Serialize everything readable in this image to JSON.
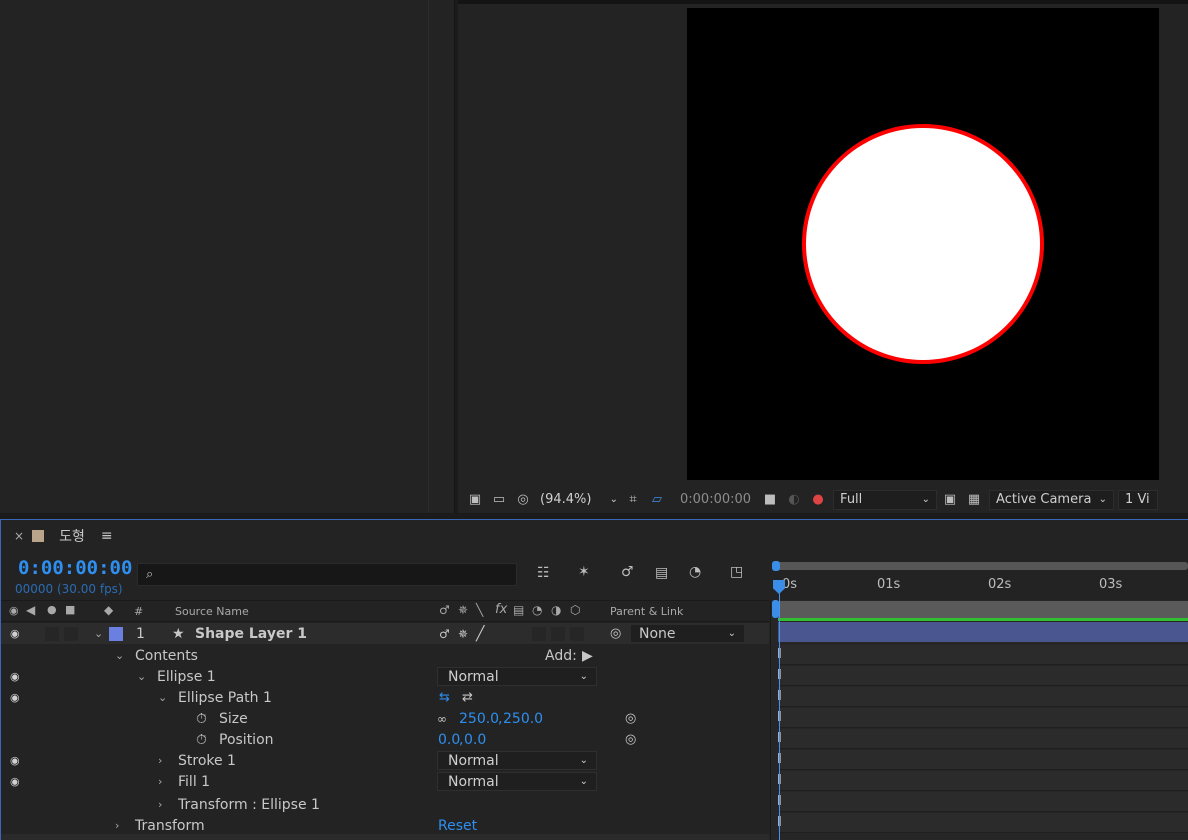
{
  "viewer": {
    "zoom": "(94.4%)",
    "time": "0:00:00:00",
    "resolution": "Full",
    "camera": "Active Camera",
    "views": "1 Vi"
  },
  "timeline": {
    "tab_close": "×",
    "tab_title": "도형",
    "tab_menu": "≡",
    "timecode": "0:00:00:00",
    "frames": "00000 (30.00 fps)",
    "search_placeholder": "",
    "columns": {
      "number": "#",
      "source_name": "Source Name",
      "parent_link": "Parent & Link",
      "fx": "fx"
    },
    "ruler": [
      "0s",
      "01s",
      "02s",
      "03s"
    ],
    "layer": {
      "number": "1",
      "name": "Shape Layer 1",
      "parent": "None",
      "label_color": "#6a7fe0"
    },
    "rows": {
      "contents": "Contents",
      "add_label": "Add:",
      "ellipse1": "Ellipse 1",
      "ellipse1_mode": "Normal",
      "ellipse_path": "Ellipse Path 1",
      "size": "Size",
      "size_value_x": "250.0",
      "size_value_y": "250.0",
      "position": "Position",
      "position_value_x": "0.0",
      "position_value_y": "0.0",
      "stroke1": "Stroke 1",
      "stroke1_mode": "Normal",
      "fill1": "Fill 1",
      "fill1_mode": "Normal",
      "transform_ellipse": "Transform : Ellipse 1",
      "transform": "Transform",
      "reset": "Reset"
    }
  },
  "colors": {
    "accent": "#2e8ff0",
    "stroke": "#ff0000",
    "fill": "#ffffff",
    "layer_bar": "#4a5690",
    "work_area": "#2fbf31"
  }
}
